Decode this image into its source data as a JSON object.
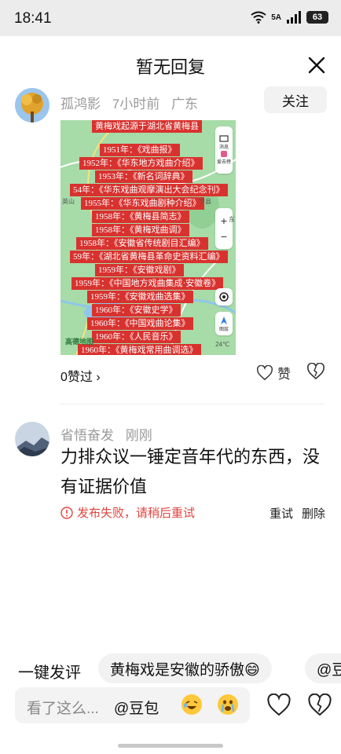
{
  "status_bar": {
    "time": "18:41",
    "network": "5A",
    "battery": "63"
  },
  "header": {
    "title": "暂无回复"
  },
  "comment1": {
    "user": "孤鸿影",
    "time": "7小时前",
    "location": "广东",
    "follow_label": "关注",
    "image": {
      "top_line": "黄梅戏起源于湖北省黄梅县",
      "rows": [
        "1951年：《戏曲报》",
        "1952年：《华东地方戏曲介绍》",
        "1953年：《新名词辞典》",
        "54年：《华东戏曲观摩演出大会纪念刊》",
        "1955年：《华东戏曲剧种介绍》",
        "1958年：《黄梅县简志》",
        "1958年：《黄梅戏曲调》",
        "1958年：《安徽省传统剧目汇编》",
        "59年：《湖北省黄梅县革命史资料汇编》",
        "1959年：《安徽戏剧》",
        "1959年：《中国地方戏曲集成·安徽卷》",
        "1959年：《安徽戏曲选集》",
        "1960年：《安徽史学》",
        "1960年：《中国戏曲论集》",
        "1960年：《人民音乐》",
        "1960年：《黄梅戏常用曲调选》"
      ],
      "map_labels": {
        "news": "消息",
        "bar": "爱去榜",
        "layers": "图层",
        "temp": "24℃",
        "place1": "英山",
        "place2": "宁县",
        "place3": "东",
        "logo": "高德地图"
      },
      "zoom_in": "+",
      "zoom_out": "−"
    },
    "likes_label": "0赞过 ›",
    "zan_label": "赞"
  },
  "comment2": {
    "user": "省悟奋发",
    "time": "刚刚",
    "text": "力排众议一锤定音年代的东西，没有证据价值",
    "fail_text": "发布失败，请稍后重试",
    "retry_label": "重试",
    "delete_label": "删除"
  },
  "quick_reply": {
    "label": "一键发评",
    "chips": [
      "黄梅戏是安徽的骄傲😄",
      "@豆包"
    ]
  },
  "input": {
    "placeholder": "看了这么...",
    "mention": "@豆包"
  },
  "icons": [
    "wifi-icon",
    "signal-icon",
    "battery-icon",
    "close-icon",
    "heart-icon",
    "broken-heart-icon",
    "error-icon",
    "locate-icon",
    "compass-icon",
    "emoji-icon"
  ],
  "colors": {
    "accent_red": "#d8322f",
    "error_red": "#e2453e",
    "map_green": "#a7dba8",
    "chip_bg": "#f2f2f2"
  }
}
